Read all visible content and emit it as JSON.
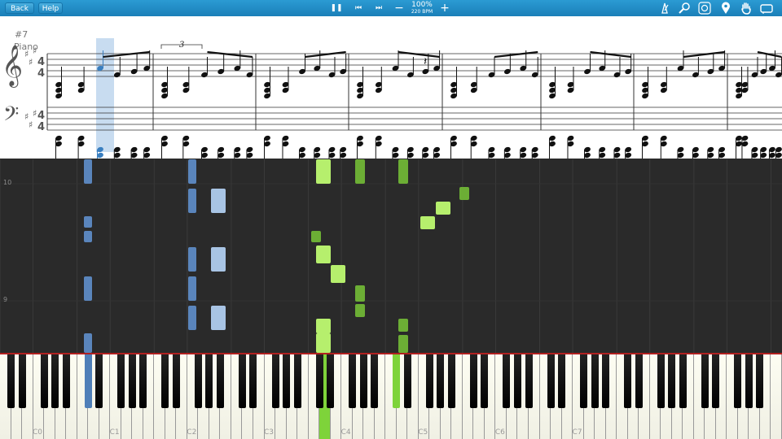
{
  "toolbar": {
    "back_label": "Back",
    "help_label": "Help",
    "zoom_label": "100%",
    "tempo_label": "220 BPM",
    "pause_glyph": "❚❚",
    "prev_glyph": "⏮",
    "next_glyph": "⏭",
    "minus_glyph": "−",
    "plus_glyph": "+",
    "icons": [
      "metronome-icon",
      "search-icon",
      "loop-icon",
      "location-pin-icon",
      "hand-icon",
      "keyboard-icon"
    ]
  },
  "score": {
    "measure_number": "#7",
    "instrument_name": "Piano",
    "tuplet_label": "3"
  },
  "roll": {
    "measure_labels": [
      "10",
      "9"
    ]
  },
  "keyboard": {
    "octave_labels": [
      "C0",
      "C1",
      "C2",
      "C3",
      "C4",
      "C5",
      "C6",
      "C7"
    ],
    "active_left_color": "#4f7fb8",
    "active_right_color": "#7ed33a"
  },
  "colors": {
    "toolbar": "#1f8ac4",
    "left_hand": "#5a85bc",
    "right_hand": "#86d147",
    "track": "#2a2a2a"
  }
}
